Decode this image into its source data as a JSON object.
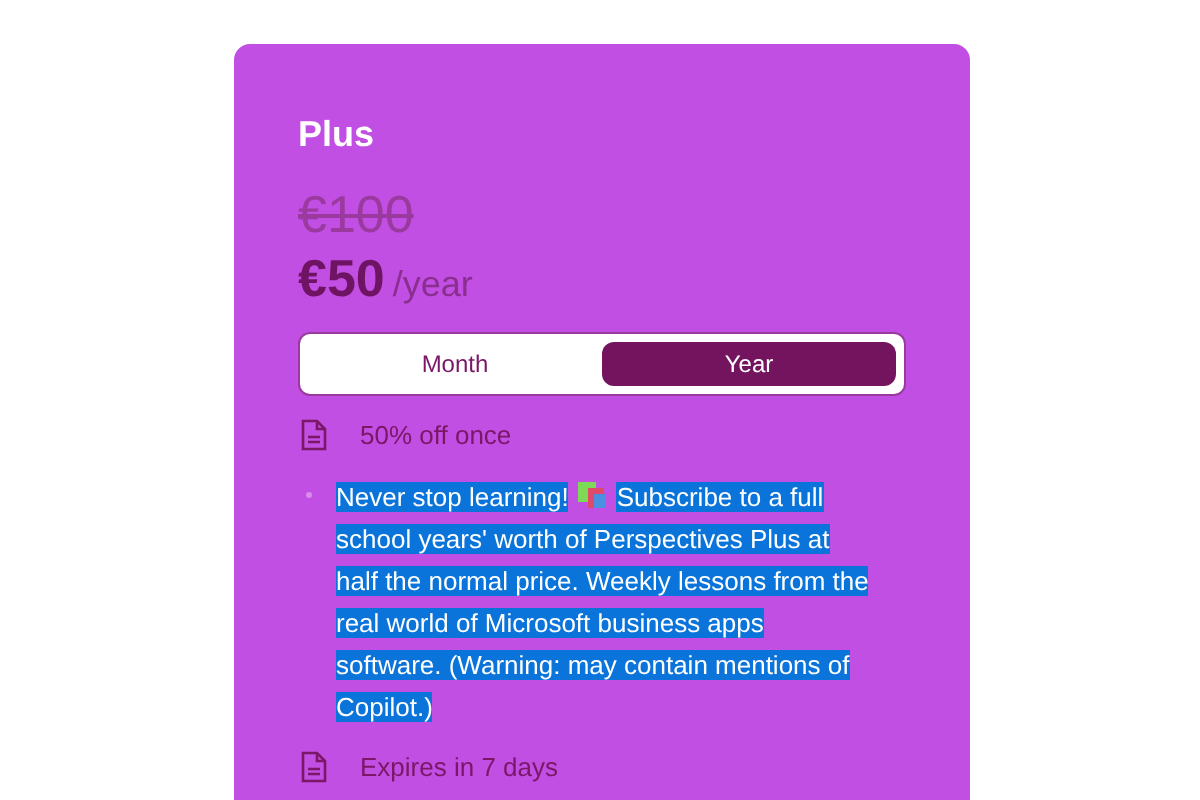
{
  "plan": {
    "name": "Plus",
    "old_price": "€100",
    "price": "€50",
    "period": "/year"
  },
  "billing_options": [
    {
      "label": "Month",
      "selected": false
    },
    {
      "label": "Year",
      "selected": true
    }
  ],
  "features": [
    {
      "kind": "icon",
      "text": "50% off once"
    },
    {
      "kind": "bullet",
      "text": "Never stop learning!",
      "text_after": "Subscribe to a full school years' worth of Perspectives Plus at half the normal price. Weekly lessons from the real world of Microsoft business apps software. (Warning: may contain mentions of Copilot.)",
      "highlighted": true
    },
    {
      "kind": "icon",
      "text": "Expires in 7 days"
    }
  ]
}
